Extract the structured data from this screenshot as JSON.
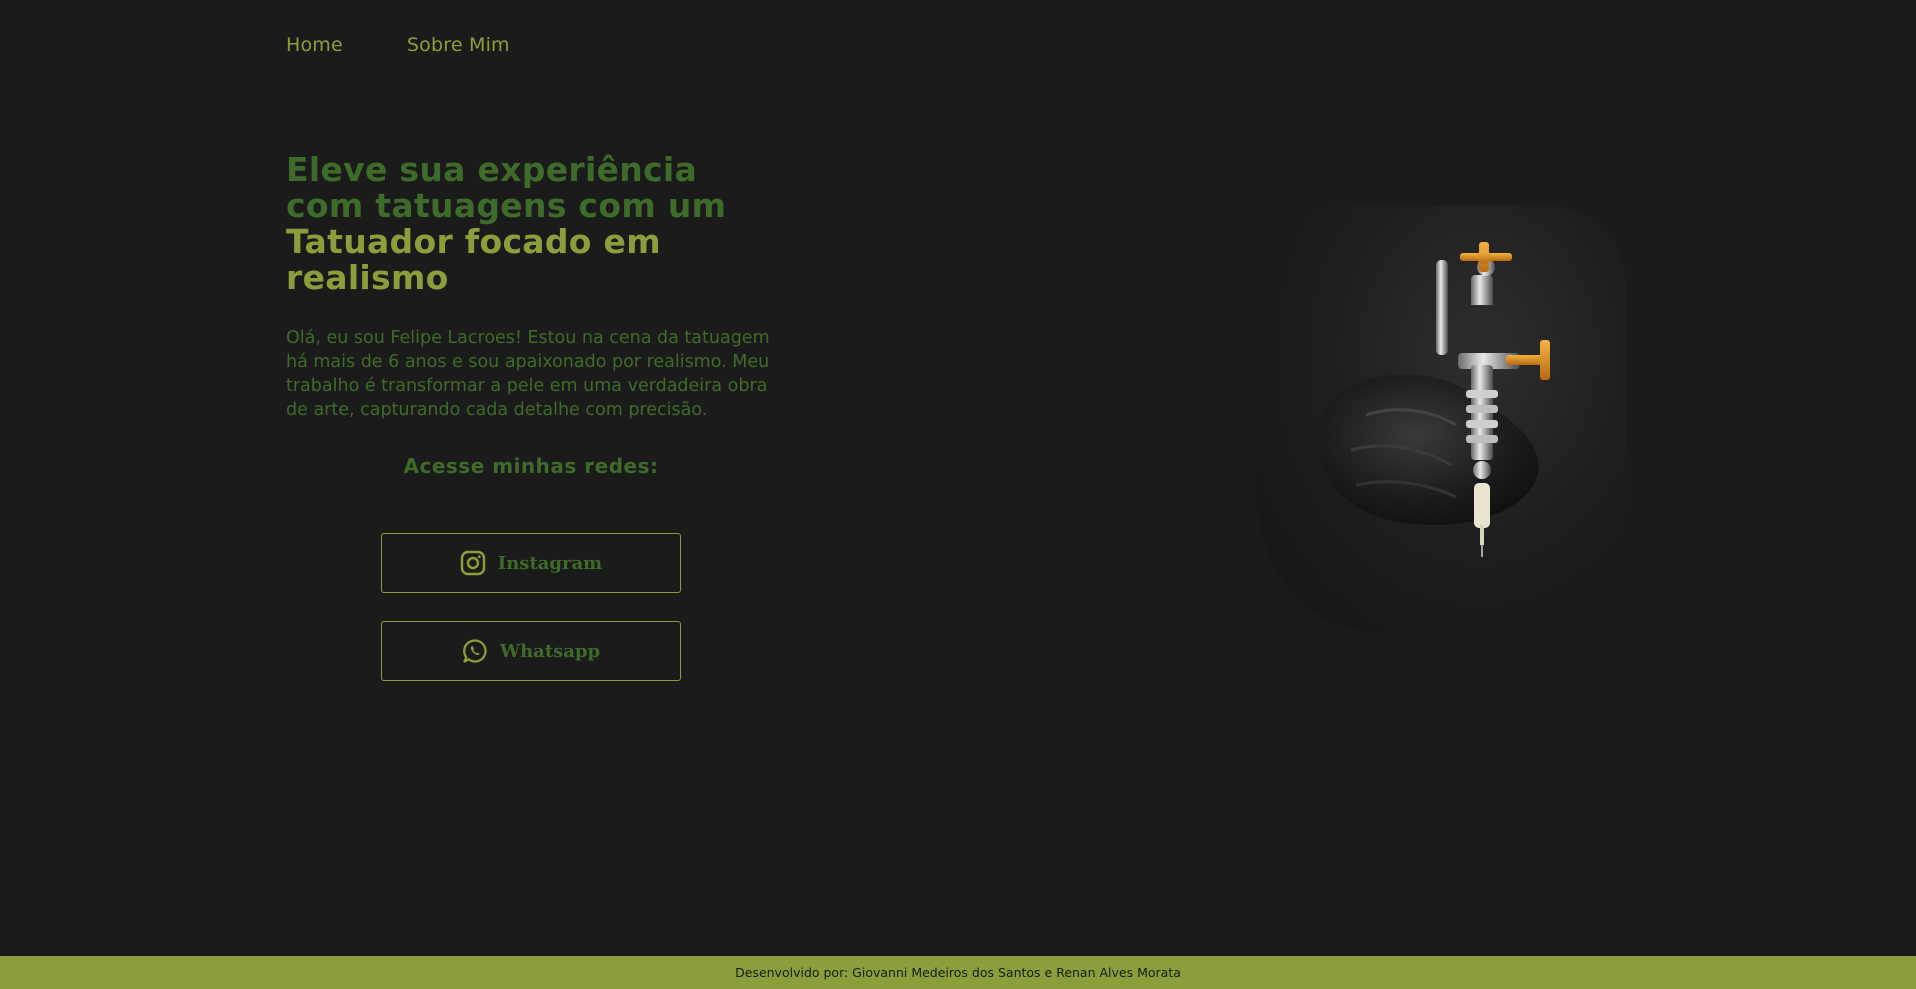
{
  "nav": {
    "items": [
      {
        "label": "Home"
      },
      {
        "label": "Sobre Mim"
      }
    ]
  },
  "hero": {
    "headline_lead": "Eleve sua experiência com tatuagens com um",
    "headline_accent": "Tatuador focado em realismo",
    "bio": "Olá, eu sou Felipe Lacroes! Estou na cena da tatuagem há mais de 6 anos e sou apaixonado por realismo. Meu trabalho é transformar a pele em uma verdadeira obra de arte, capturando cada detalhe com precisão."
  },
  "socials": {
    "title": "Acesse minhas redes:",
    "instagram": {
      "label": "Instagram",
      "icon": "instagram-icon"
    },
    "whatsapp": {
      "label": "Whatsapp",
      "icon": "whatsapp-icon"
    }
  },
  "footer": {
    "text": "Desenvolvido por: Giovanni Medeiros dos Santos e Renan Alves Morata"
  },
  "colors": {
    "background": "#1b1b1b",
    "accent": "#8a9f3c",
    "text_dark_green": "#3f6b2a"
  }
}
